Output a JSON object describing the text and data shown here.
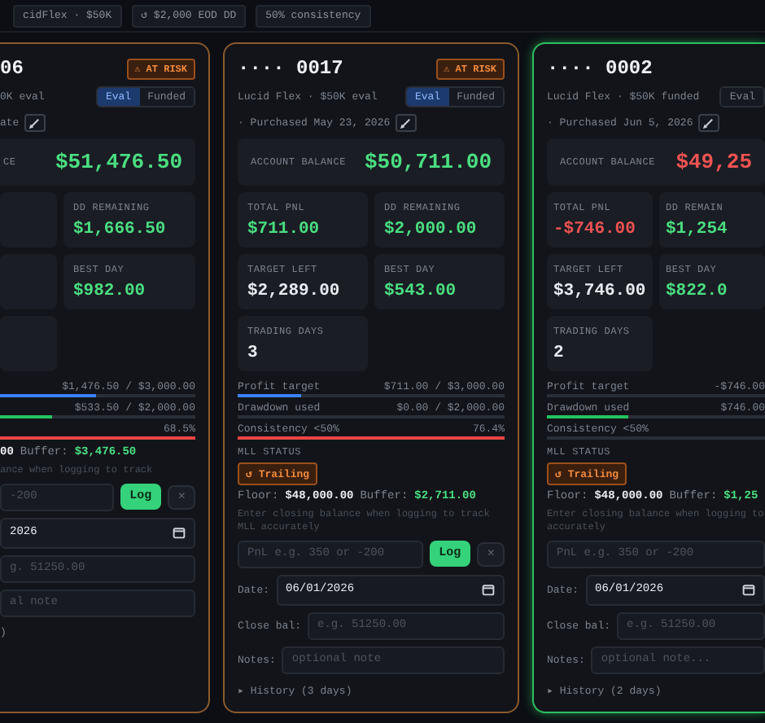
{
  "top_chips": [
    "cidFlex · $50K",
    "↺ $2,000 EOD DD",
    "50% consistency"
  ],
  "cards": [
    {
      "at_risk": true,
      "title": "06",
      "badge": "⚠ AT RISK",
      "subtitle": "0K eval",
      "toggle": [
        {
          "label": "Eval",
          "selected": true
        },
        {
          "label": "Funded",
          "selected": false
        }
      ],
      "purchased": "ate",
      "balance": {
        "label": "CE",
        "value": "$51,476.50",
        "color": "#4ade80"
      },
      "stats": [
        {
          "kind": "cut"
        },
        {
          "kind": "stat",
          "label": "DD REMAINING",
          "value": "$1,666.50",
          "color": "#4ade80"
        },
        {
          "kind": "cut"
        },
        {
          "kind": "stat",
          "label": "BEST DAY",
          "value": "$982.00",
          "color": "#4ade80"
        },
        {
          "kind": "cut"
        }
      ],
      "bars": [
        {
          "reading": "$1,476.50 / $3,000.00",
          "level": 0.49,
          "color": "#3b82f6"
        },
        {
          "reading": "$533.50 / $2,000.00",
          "level": 0.27,
          "color": "#22c55e"
        },
        {
          "reading": "68.5%",
          "level": 1,
          "color": "#ef4444"
        }
      ],
      "mll": {
        "floor": "00",
        "buffer_label": "Buffer:",
        "buffer": "$3,476.50",
        "hint": "ance when logging to track"
      },
      "pnl_placeholder": "-200",
      "log": "Log",
      "clear": "×",
      "date": {
        "value": "2026"
      },
      "close": {
        "placeholder": "g. 51250.00"
      },
      "notes": {
        "placeholder": "al note"
      },
      "history": ")"
    },
    {
      "at_risk": true,
      "title": "···· 0017",
      "badge": "⚠ AT RISK",
      "subtitle": "Lucid Flex · $50K eval",
      "toggle": [
        {
          "label": "Eval",
          "selected": true
        },
        {
          "label": "Funded",
          "selected": false
        }
      ],
      "purchased": "· Purchased May 23, 2026",
      "balance": {
        "label": "ACCOUNT BALANCE",
        "value": "$50,711.00",
        "color": "#4ade80"
      },
      "stats": [
        {
          "kind": "stat",
          "label": "TOTAL PNL",
          "value": "$711.00",
          "color": "#4ade80"
        },
        {
          "kind": "stat",
          "label": "DD REMAINING",
          "value": "$2,000.00",
          "color": "#4ade80"
        },
        {
          "kind": "stat",
          "label": "TARGET LEFT",
          "value": "$2,289.00",
          "color": "#e8eaef"
        },
        {
          "kind": "stat",
          "label": "BEST DAY",
          "value": "$543.00",
          "color": "#4ade80"
        },
        {
          "kind": "stat",
          "label": "TRADING DAYS",
          "value": "3",
          "color": "#e8eaef"
        }
      ],
      "bars": [
        {
          "label": "Profit target",
          "reading": "$711.00 / $3,000.00",
          "level": 0.24,
          "color": "#3b82f6"
        },
        {
          "label": "Drawdown used",
          "reading": "$0.00 / $2,000.00"
        },
        {
          "label": "Consistency <50%",
          "reading": "76.4%",
          "level": 1,
          "color": "#ef4444"
        }
      ],
      "mll": {
        "label": "MLL STATUS",
        "badge": "↺ Trailing",
        "floor_label": "Floor:",
        "floor": "$48,000.00",
        "buffer_label": "Buffer:",
        "buffer": "$2,711.00",
        "hint": "Enter closing balance when logging to track MLL accurately"
      },
      "pnl_placeholder": "PnL e.g. 350 or -200",
      "log": "Log",
      "clear": "×",
      "date": {
        "label": "Date:",
        "value": "06/01/2026"
      },
      "close": {
        "label": "Close bal:",
        "placeholder": "e.g. 51250.00"
      },
      "notes": {
        "label": "Notes:",
        "placeholder": "optional note"
      },
      "history": "▸ History (3 days)"
    },
    {
      "at_risk": false,
      "title": "···· 0002",
      "subtitle": "Lucid Flex · $50K funded",
      "toggle": [
        {
          "label": "Eval",
          "selected": false
        }
      ],
      "purchased": "· Purchased Jun 5, 2026",
      "balance": {
        "label": "ACCOUNT BALANCE",
        "value": "$49,25",
        "color": "#f05252"
      },
      "stats": [
        {
          "kind": "stat",
          "label": "TOTAL PNL",
          "value": "-$746.00",
          "color": "#f05252"
        },
        {
          "kind": "stat",
          "label": "DD REMAIN",
          "value": "$1,254",
          "color": "#4ade80"
        },
        {
          "kind": "stat",
          "label": "TARGET LEFT",
          "value": "$3,746.00",
          "color": "#e8eaef"
        },
        {
          "kind": "stat",
          "label": "BEST DAY",
          "value": "$822.0",
          "color": "#4ade80"
        },
        {
          "kind": "stat",
          "label": "TRADING DAYS",
          "value": "2",
          "color": "#e8eaef"
        }
      ],
      "bars": [
        {
          "label": "Profit target",
          "reading": "-$746.00"
        },
        {
          "label": "Drawdown used",
          "reading": "$746.00",
          "level": 0.37,
          "color": "#22c55e"
        },
        {
          "label": "Consistency <50%"
        }
      ],
      "mll": {
        "label": "MLL STATUS",
        "badge": "↺ Trailing",
        "floor_label": "Floor:",
        "floor": "$48,000.00",
        "buffer_label": "Buffer:",
        "buffer": "$1,25",
        "hint": "Enter closing balance when logging to accurately"
      },
      "pnl_placeholder": "PnL e.g. 350 or -200",
      "date": {
        "label": "Date:",
        "value": "06/01/2026"
      },
      "close": {
        "label": "Close bal:",
        "placeholder": "e.g. 51250.00"
      },
      "notes": {
        "label": "Notes:",
        "placeholder": "optional note..."
      },
      "history": "▸ History (2 days)"
    }
  ]
}
